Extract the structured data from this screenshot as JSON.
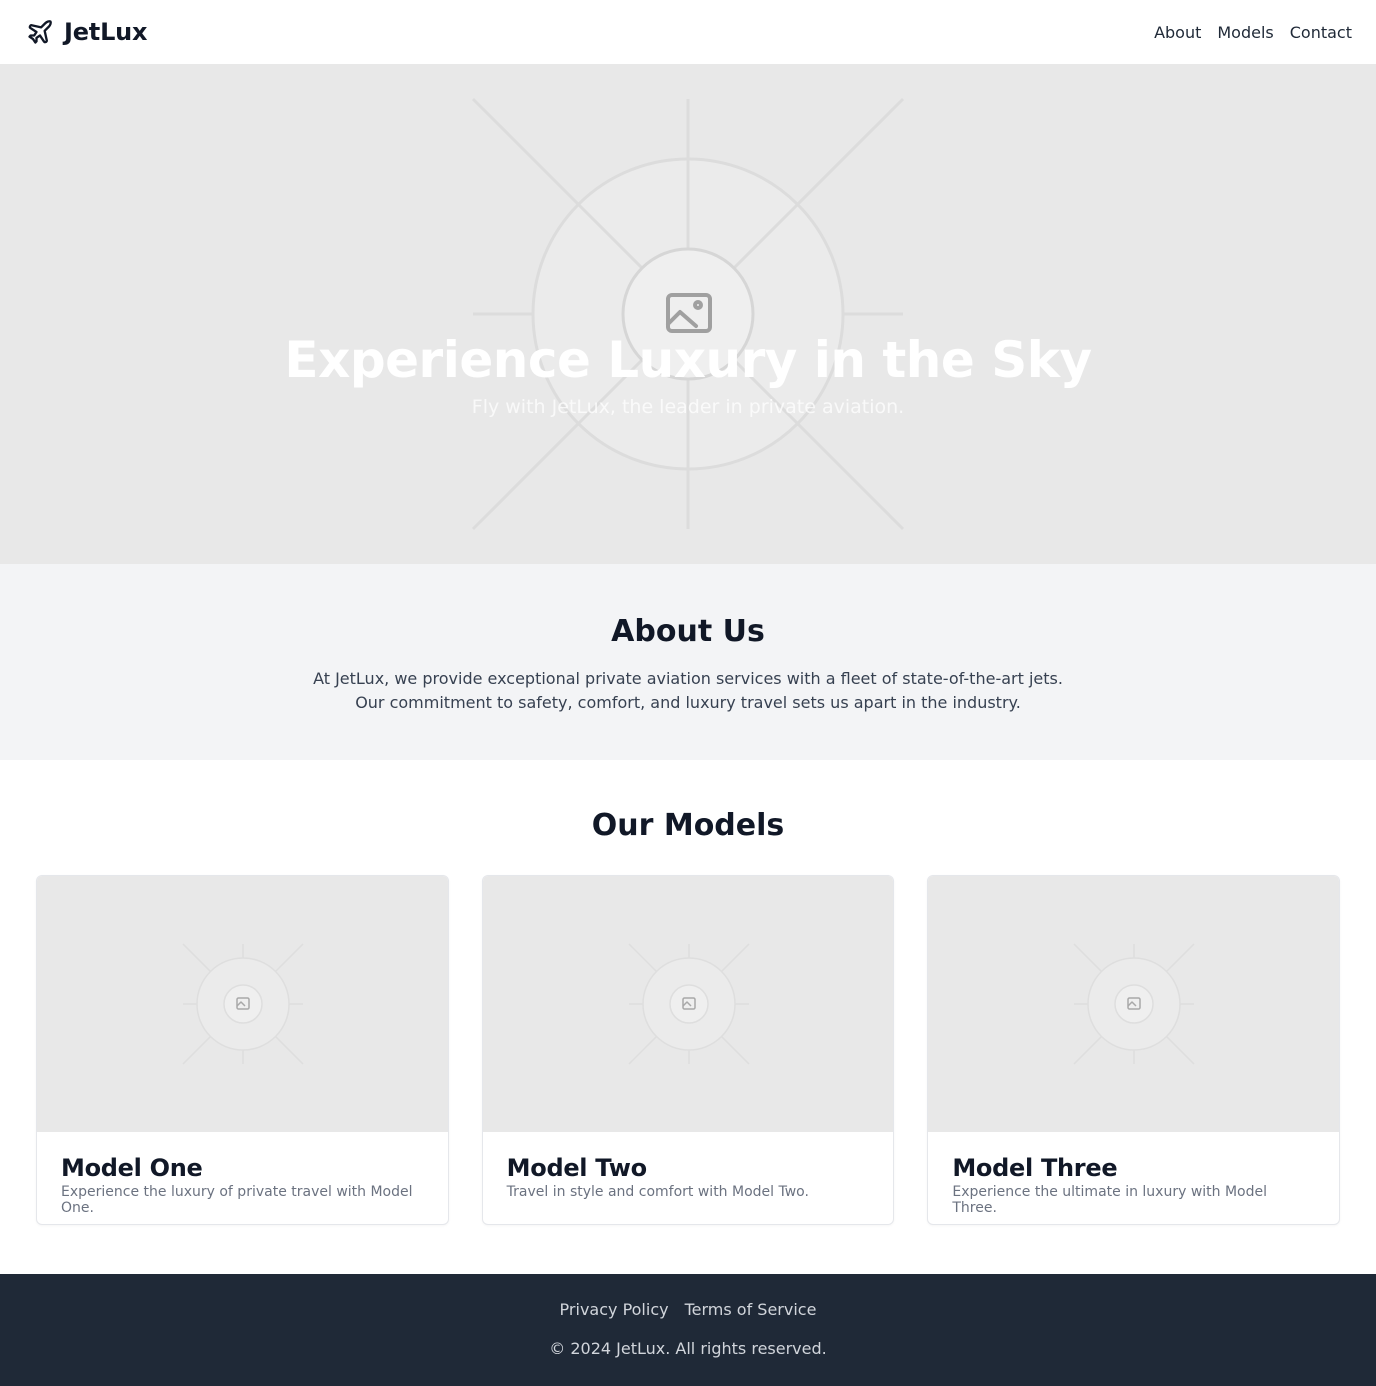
{
  "header": {
    "brand": "JetLux",
    "brand_icon": "airplane-icon",
    "nav": [
      {
        "label": "About"
      },
      {
        "label": "Models"
      },
      {
        "label": "Contact"
      }
    ]
  },
  "hero": {
    "title": "Experience Luxury in the Sky",
    "subtitle": "Fly with JetLux, the leader in private aviation.",
    "image_icon": "image-placeholder-icon"
  },
  "about": {
    "title": "About Us",
    "text": "At JetLux, we provide exceptional private aviation services with a fleet of state-of-the-art jets. Our commitment to safety, comfort, and luxury travel sets us apart in the industry."
  },
  "models": {
    "title": "Our Models",
    "cards": [
      {
        "title": "Model One",
        "description": "Experience the luxury of private travel with Model One."
      },
      {
        "title": "Model Two",
        "description": "Travel in style and comfort with Model Two."
      },
      {
        "title": "Model Three",
        "description": "Experience the ultimate in luxury with Model Three."
      }
    ]
  },
  "footer": {
    "links": [
      {
        "label": "Privacy Policy"
      },
      {
        "label": "Terms of Service"
      }
    ],
    "copyright": "© 2024 JetLux. All rights reserved."
  },
  "colors": {
    "footer_bg": "#1f2937",
    "about_bg": "#f3f4f6",
    "placeholder_bg": "#e8e8e8"
  }
}
